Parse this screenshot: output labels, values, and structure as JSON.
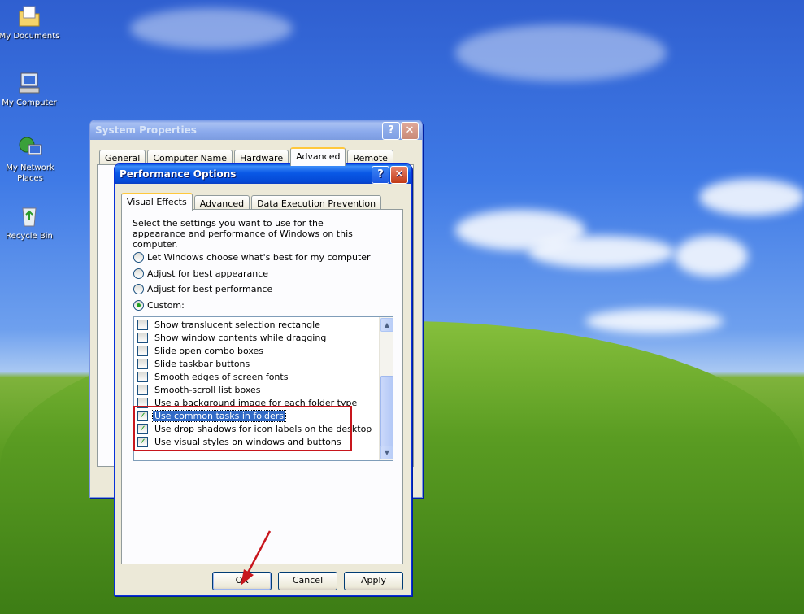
{
  "desktop": {
    "icons": [
      {
        "label": "My Documents",
        "icon": "my-documents-icon"
      },
      {
        "label": "My Computer",
        "icon": "my-computer-icon"
      },
      {
        "label": "My Network Places",
        "icon": "network-places-icon"
      },
      {
        "label": "Recycle Bin",
        "icon": "recycle-bin-icon"
      }
    ]
  },
  "system_properties": {
    "title": "System Properties",
    "tabs": [
      "General",
      "Computer Name",
      "Hardware",
      "Advanced",
      "Remote"
    ],
    "selected_tab": "Advanced"
  },
  "performance_options": {
    "title": "Performance Options",
    "tabs": [
      "Visual Effects",
      "Advanced",
      "Data Execution Prevention"
    ],
    "selected_tab": "Visual Effects",
    "description": "Select the settings you want to use for the appearance and performance of Windows on this computer.",
    "radios": [
      {
        "label": "Let Windows choose what's best for my computer",
        "checked": false
      },
      {
        "label": "Adjust for best appearance",
        "checked": false
      },
      {
        "label": "Adjust for best performance",
        "checked": false
      },
      {
        "label": "Custom:",
        "checked": true
      }
    ],
    "effects": [
      {
        "label": "Show translucent selection rectangle",
        "checked": false
      },
      {
        "label": "Show window contents while dragging",
        "checked": false
      },
      {
        "label": "Slide open combo boxes",
        "checked": false
      },
      {
        "label": "Slide taskbar buttons",
        "checked": false
      },
      {
        "label": "Smooth edges of screen fonts",
        "checked": false
      },
      {
        "label": "Smooth-scroll list boxes",
        "checked": false
      },
      {
        "label": "Use a background image for each folder type",
        "checked": false
      },
      {
        "label": "Use common tasks in folders",
        "checked": true,
        "highlighted": true
      },
      {
        "label": "Use drop shadows for icon labels on the desktop",
        "checked": true
      },
      {
        "label": "Use visual styles on windows and buttons",
        "checked": true
      }
    ],
    "buttons": {
      "ok": "OK",
      "cancel": "Cancel",
      "apply": "Apply"
    }
  },
  "colors": {
    "annotation_red": "#c8161d",
    "xp_blue": "#0a5fe0",
    "selection_blue": "#316ac5"
  }
}
